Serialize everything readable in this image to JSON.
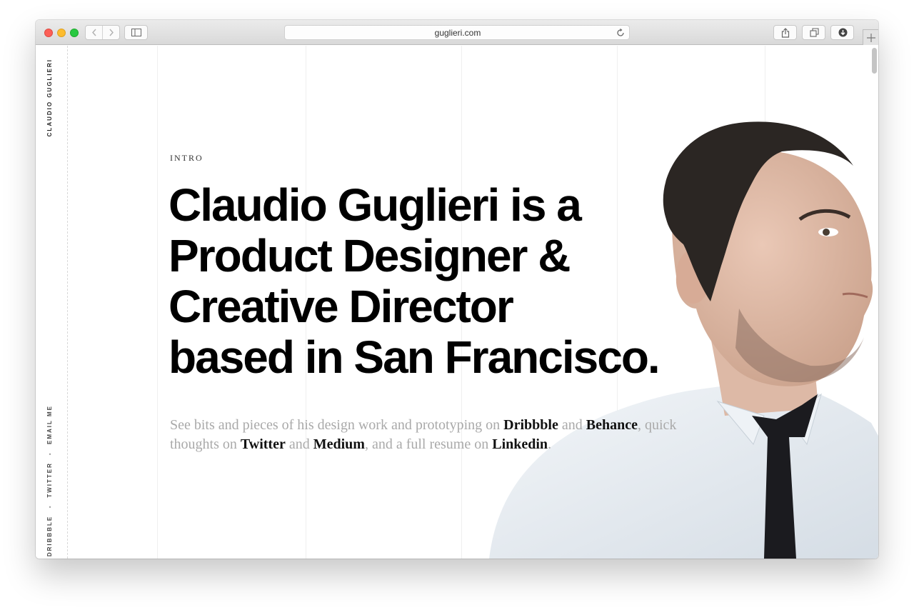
{
  "browser": {
    "url": "guglieri.com",
    "colors": {
      "close": "#fc5f57",
      "minimize": "#fdbc2e",
      "zoom": "#28c840"
    }
  },
  "sidebar": {
    "brand": "CLAUDIO GUGLIERI",
    "links": [
      {
        "label": "DRIBBBLE"
      },
      {
        "label": "TWITTER"
      },
      {
        "label": "EMAIL ME"
      }
    ],
    "separator": "-"
  },
  "hero": {
    "section_label": "INTRO",
    "headline_lines": [
      "Claudio Guglieri is a",
      "Product Designer &",
      "Creative Director",
      "based in San Francisco."
    ],
    "blurb": {
      "t1": "See bits and pieces of his design work and prototyping on ",
      "link_dribbble": "Dribbble",
      "t2": " and ",
      "link_behance": "Behance",
      "t3": ", quick thoughts on ",
      "link_twitter": "Twitter",
      "t4": " and ",
      "link_medium": "Medium",
      "t5": ", and a full resume on ",
      "link_linkedin": "Linkedin",
      "t6": "."
    }
  }
}
